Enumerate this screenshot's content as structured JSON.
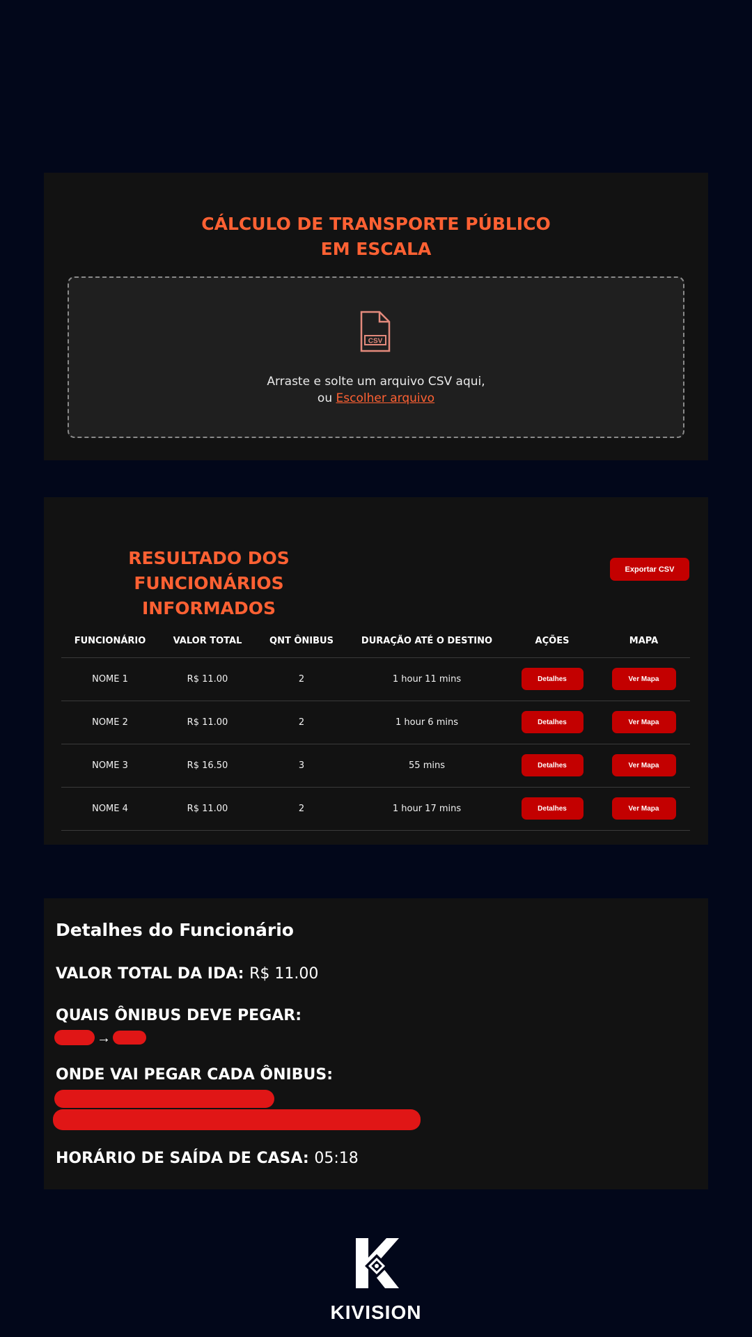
{
  "upload": {
    "title_line1": "CÁLCULO DE TRANSPORTE PÚBLICO",
    "title_line2": "EM ESCALA",
    "icon": "csv-file-icon",
    "icon_label": "CSV",
    "drop_text": "Arraste e solte um arquivo CSV aqui,",
    "or_text": "ou ",
    "choose_file": "Escolher arquivo"
  },
  "results": {
    "title_line1": "RESULTADO DOS FUNCIONÁRIOS",
    "title_line2": "INFORMADOS",
    "export_label": "Exportar CSV",
    "columns": [
      "FUNCIONÁRIO",
      "VALOR TOTAL",
      "QNT ÔNIBUS",
      "DURAÇÃO ATÉ O DESTINO",
      "AÇÕES",
      "MAPA"
    ],
    "rows": [
      {
        "name": "NOME 1",
        "total": "R$ 11.00",
        "buses": "2",
        "duration": "1 hour 11 mins",
        "action": "Detalhes",
        "map": "Ver Mapa"
      },
      {
        "name": "NOME 2",
        "total": "R$ 11.00",
        "buses": "2",
        "duration": "1 hour 6 mins",
        "action": "Detalhes",
        "map": "Ver Mapa"
      },
      {
        "name": "NOME 3",
        "total": "R$ 16.50",
        "buses": "3",
        "duration": "55 mins",
        "action": "Detalhes",
        "map": "Ver Mapa"
      },
      {
        "name": "NOME 4",
        "total": "R$ 11.00",
        "buses": "2",
        "duration": "1 hour 17 mins",
        "action": "Detalhes",
        "map": "Ver Mapa"
      }
    ]
  },
  "details": {
    "heading": "Detalhes do Funcionário",
    "total_label": "VALOR TOTAL DA IDA:",
    "total_value": "R$ 11.00",
    "buses_label": "QUAIS ÔNIBUS DEVE PEGAR:",
    "bus_arrow": "→",
    "where_label": "ONDE VAI PEGAR CADA ÔNIBUS:",
    "departure_label": "HORÁRIO DE SAÍDA DE CASA:",
    "departure_value": "05:18"
  },
  "footer": {
    "logo_text": "KIVISION"
  },
  "colors": {
    "background": "#02071a",
    "panel": "#121212",
    "accent": "#ff6133",
    "button": "#c30000",
    "redaction": "#e01616"
  }
}
